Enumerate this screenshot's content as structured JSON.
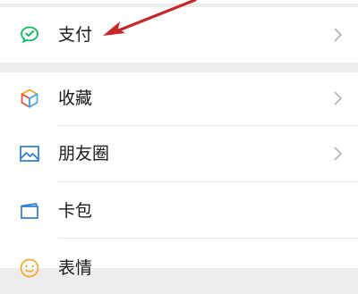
{
  "colors": {
    "background": "#ededed",
    "row_background": "#ffffff",
    "text": "#1a1a1a",
    "chevron": "#b2b2b2",
    "pay_icon": "#07c160",
    "annotation_arrow": "#c62828",
    "favorites_icon": [
      "#f5a623",
      "#e94b3c",
      "#3fa7f0",
      "#7ed321"
    ],
    "moments_icon": "#2b7bd6",
    "cards_icon": "#2b7bd6",
    "stickers_icon": "#f5a623"
  },
  "menu": {
    "pay": {
      "label": "支付",
      "icon": "wechat-pay-icon"
    },
    "items": [
      {
        "label": "收藏",
        "icon": "favorites-cube-icon"
      },
      {
        "label": "朋友圈",
        "icon": "moments-picture-icon"
      },
      {
        "label": "卡包",
        "icon": "card-wallet-icon"
      },
      {
        "label": "表情",
        "icon": "sticker-smile-icon"
      }
    ]
  },
  "annotation": {
    "type": "arrow",
    "points_to": "pay"
  }
}
